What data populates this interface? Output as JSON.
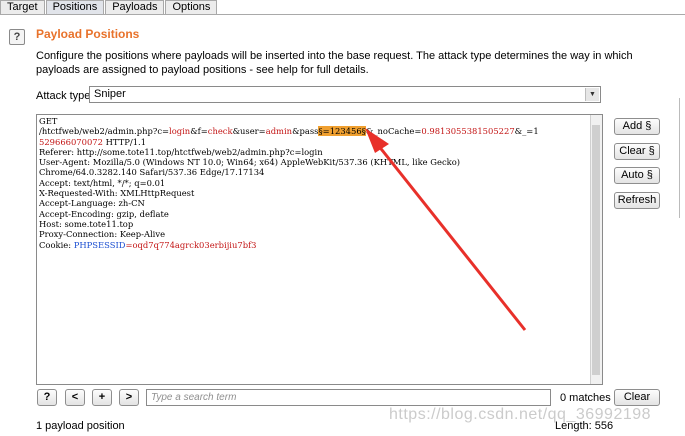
{
  "tabs": [
    "Target",
    "Positions",
    "Payloads",
    "Options"
  ],
  "help_icon": "?",
  "title": "Payload Positions",
  "description": "Configure the positions where payloads will be inserted into the base request. The attack type determines the way in which payloads are assigned to payload positions - see help for full details.",
  "attack_type": {
    "label": "Attack type:",
    "value": "Sniper"
  },
  "request": {
    "line1": "GET",
    "line2_a": "/htctfweb/web2/admin.php?c=",
    "line2_b": "login",
    "line2_c": "&f=",
    "line2_d": "check",
    "line2_e": "&user=",
    "line2_f": "admin",
    "line2_g": "&pass",
    "line2_h": "§=123456§",
    "line2_i": "&_noCache=",
    "line2_j": "0.9813055381505227",
    "line2_k": "&_=1",
    "line3_a": "529666070072",
    "line3_b": " HTTP/1.1",
    "line4": "Referer: http://some.tote11.top/htctfweb/web2/admin.php?c=login",
    "line5": "User-Agent: Mozilla/5.0 (Windows NT 10.0; Win64; x64) AppleWebKit/537.36 (KHTML, like Gecko)",
    "line6": "Chrome/64.0.3282.140 Safari/537.36 Edge/17.17134",
    "line7": "Accept: text/html, */*; q=0.01",
    "line8": "X-Requested-With: XMLHttpRequest",
    "line9": "Accept-Language: zh-CN",
    "line10": "Accept-Encoding: gzip, deflate",
    "line11": "Host: some.tote11.top",
    "line12": "Proxy-Connection: Keep-Alive",
    "line13_a": "Cookie: ",
    "line13_b": "PHPSESSID",
    "line13_c": "=oqd7q774agrck03erbijiu7bf3"
  },
  "side_buttons": {
    "add": "Add §",
    "clear": "Clear §",
    "auto": "Auto §",
    "refresh": "Refresh"
  },
  "nav": {
    "help": "?",
    "prev": "<",
    "add": "+",
    "next": ">"
  },
  "search": {
    "placeholder": "Type a search term"
  },
  "matches": "0 matches",
  "clear_button": "Clear",
  "footer": {
    "positions": "1 payload position",
    "length": "Length: 556"
  },
  "watermark": "https://blog.csdn.net/qq_36992198",
  "colors": {
    "title": "#e8722b",
    "param_value": "#c31515",
    "cookie_name": "#1c4fd1",
    "payload_marker": "#f0a030",
    "annotation_arrow": "#e8302a"
  }
}
